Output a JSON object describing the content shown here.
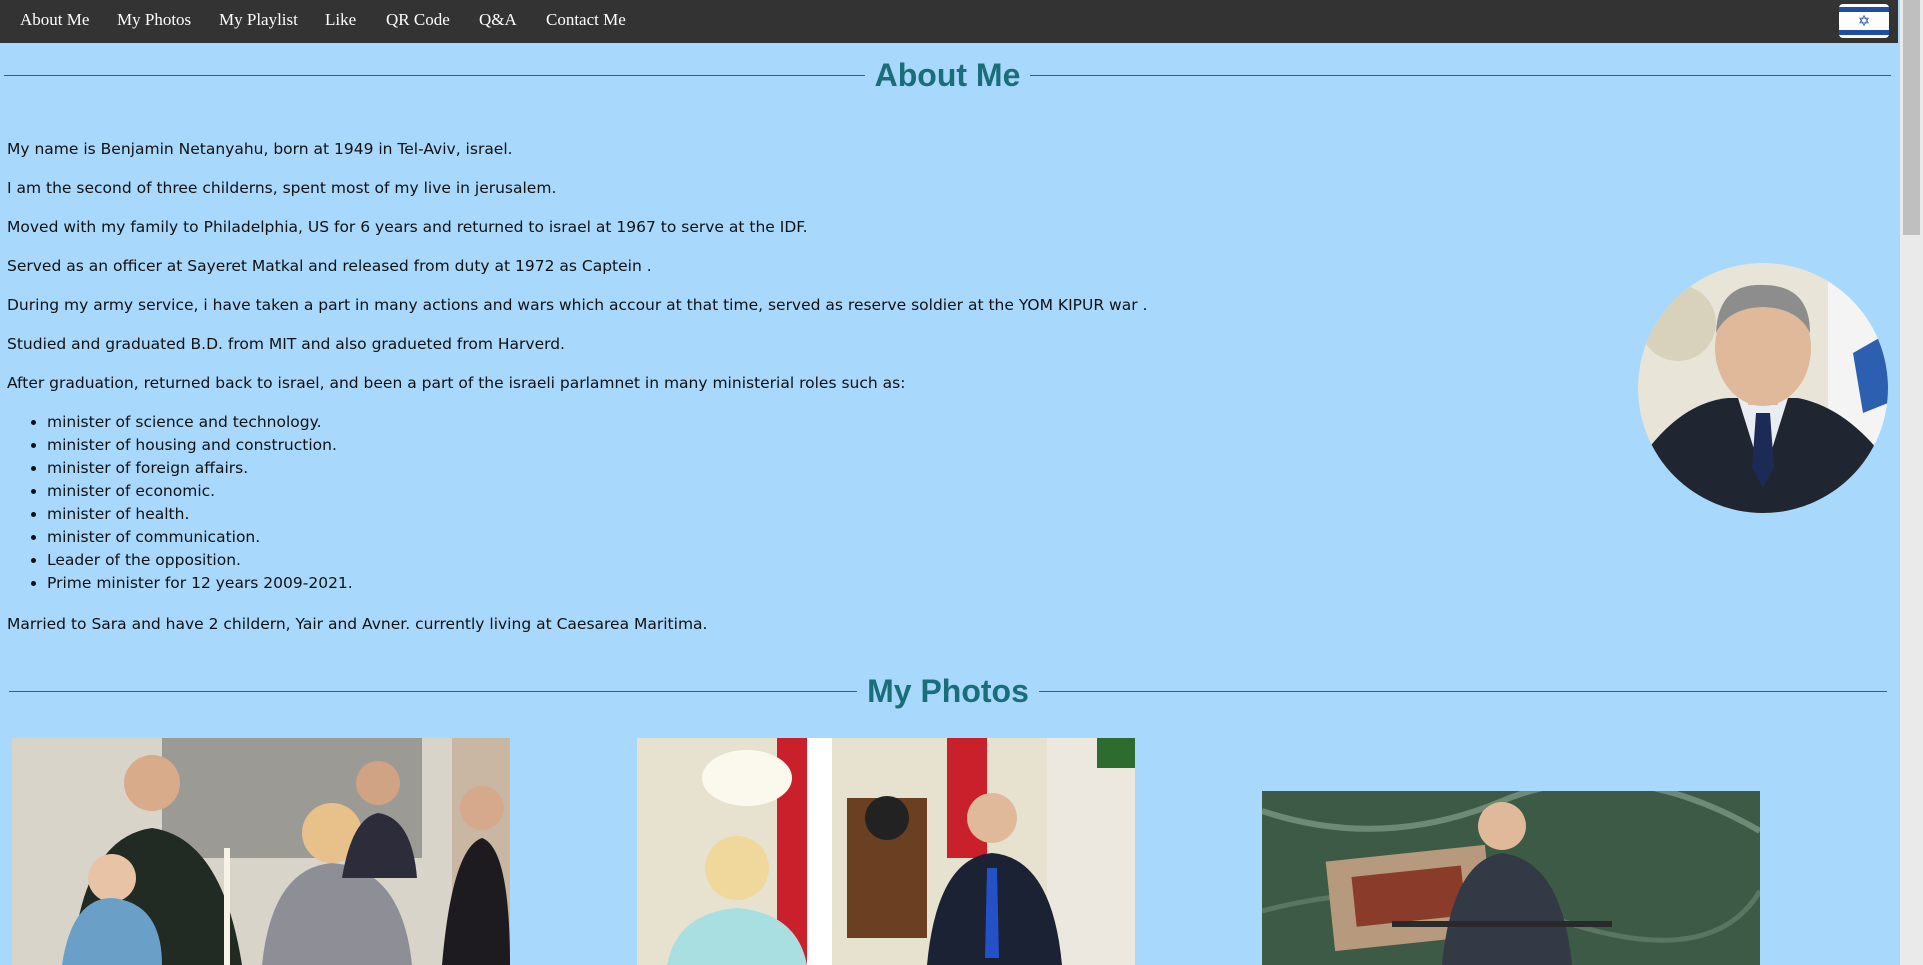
{
  "nav": {
    "items": [
      "About Me",
      "My Photos",
      "My Playlist",
      "Like",
      "QR Code",
      "Q&A",
      "Contact Me"
    ],
    "flag_icon": "israel-flag-icon"
  },
  "about": {
    "heading": "About Me",
    "paragraphs": [
      "My name is Benjamin Netanyahu, born at 1949 in Tel-Aviv, israel.",
      "I am the second of three childerns, spent most of my live in jerusalem.",
      "Moved with my family to Philadelphia, US for 6 years and returned to israel at 1967 to serve at the IDF.",
      "Served as an officer at Sayeret Matkal and released from duty at 1972 as Captein .",
      "During my army service, i have taken a part in many actions and wars which accour at that time, served as reserve soldier at the YOM KIPUR war .",
      "Studied and graduated B.D. from MIT and also gradueted from Harverd.",
      "After graduation, returned back to israel, and been a part of the israeli parlamnet in many ministerial roles such as:"
    ],
    "roles": [
      "minister of science and technology.",
      "minister of housing and construction.",
      "minister of foreign affairs.",
      "minister of economic.",
      "minister of health.",
      "minister of communication.",
      "Leader of the opposition.",
      "Prime minister for 12 years 2009-2021."
    ],
    "closing": "Married to Sara and have 2 childern, Yair and Avner. currently living at Caesarea Maritima."
  },
  "photos": {
    "heading": "My Photos"
  },
  "colors": {
    "background": "#a8d8fb",
    "navbar": "#333333",
    "heading": "#1a6e79"
  }
}
